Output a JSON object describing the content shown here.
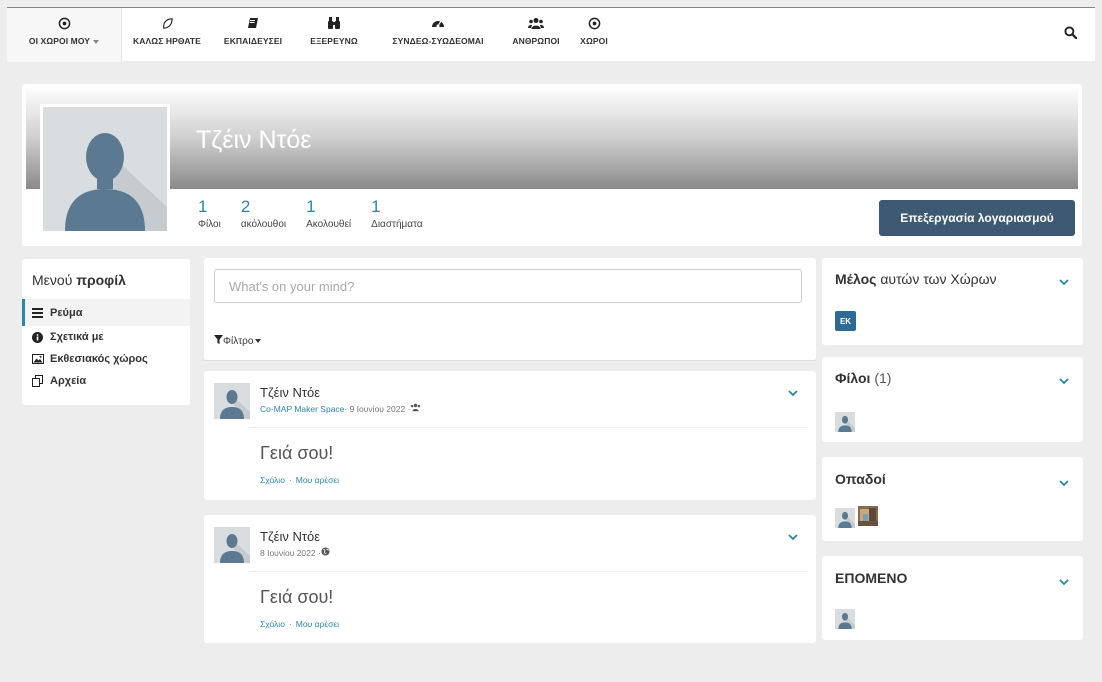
{
  "nav": {
    "items": [
      {
        "label": "ΟΙ ΧΩΡΟΙ ΜΟΥ",
        "icon": "target-icon"
      },
      {
        "label": "ΚΑΛΩΣ ΗΡΘΑΤΕ",
        "icon": "leaf-icon"
      },
      {
        "label": "ΕΚΠΑΙΔΕΥΣΕΙ",
        "icon": "book-icon"
      },
      {
        "label": "ΕΞΕΡΕΥΝΩ",
        "icon": "binoculars-icon"
      },
      {
        "label": "ΣΥΝΔΕΩ-ΣΥΩΔΕΟΜΑΙ",
        "icon": "dashboard-icon"
      },
      {
        "label": "ΑΝΘΡΩΠΟΙ",
        "icon": "users-icon"
      },
      {
        "label": "ΧΩΡΟΙ",
        "icon": "target-icon"
      }
    ]
  },
  "profile": {
    "name": "Τζέιν Ντόε",
    "counts": [
      {
        "num": "1",
        "label": "Φίλοι"
      },
      {
        "num": "2",
        "label": "ακόλουθοι"
      },
      {
        "num": "1",
        "label": "Ακολουθεί"
      },
      {
        "num": "1",
        "label": "Διαστήματα"
      }
    ],
    "edit_label": "Επεξεργασία λογαριασμού"
  },
  "menu": {
    "title_normal": "Μενού",
    "title_bold": "προφίλ",
    "items": [
      "Ρεύμα",
      "Σχετικά με",
      "Εκθεσιακός χώρος",
      "Αρχεία"
    ]
  },
  "composer": {
    "placeholder": "What's on your mind?",
    "filter_label": "Φίλτρο"
  },
  "posts": [
    {
      "author": "Τζέιν Ντόε",
      "space": "Co-MAP Maker Space",
      "date": " · 9 Ιουνίου 2022 · ",
      "body": "Γειά σου!",
      "comment": "Σχόλιο",
      "like": "Μου αρέσει",
      "sep": "·"
    },
    {
      "author": "Τζέιν Ντόε",
      "date": "8 Ιουνίου 2022 · ",
      "body": "Γειά σου!",
      "comment": "Σχόλιο",
      "like": "Μου αρέσει",
      "sep": "·"
    }
  ],
  "sidebar": {
    "member": {
      "title_bold": "Μέλος",
      "title_rest": " αυτών των Χώρων",
      "badge": "ΕΚ"
    },
    "friends": {
      "title": "Φίλοι",
      "count": " (1)"
    },
    "followers": {
      "title": "Οπαδοί"
    },
    "following": {
      "title": "ΕΠΟΜΕΝΟ"
    }
  },
  "colors": {
    "accent": "#2a87a8",
    "button": "#3d5a72",
    "badge": "#2f6a95"
  }
}
